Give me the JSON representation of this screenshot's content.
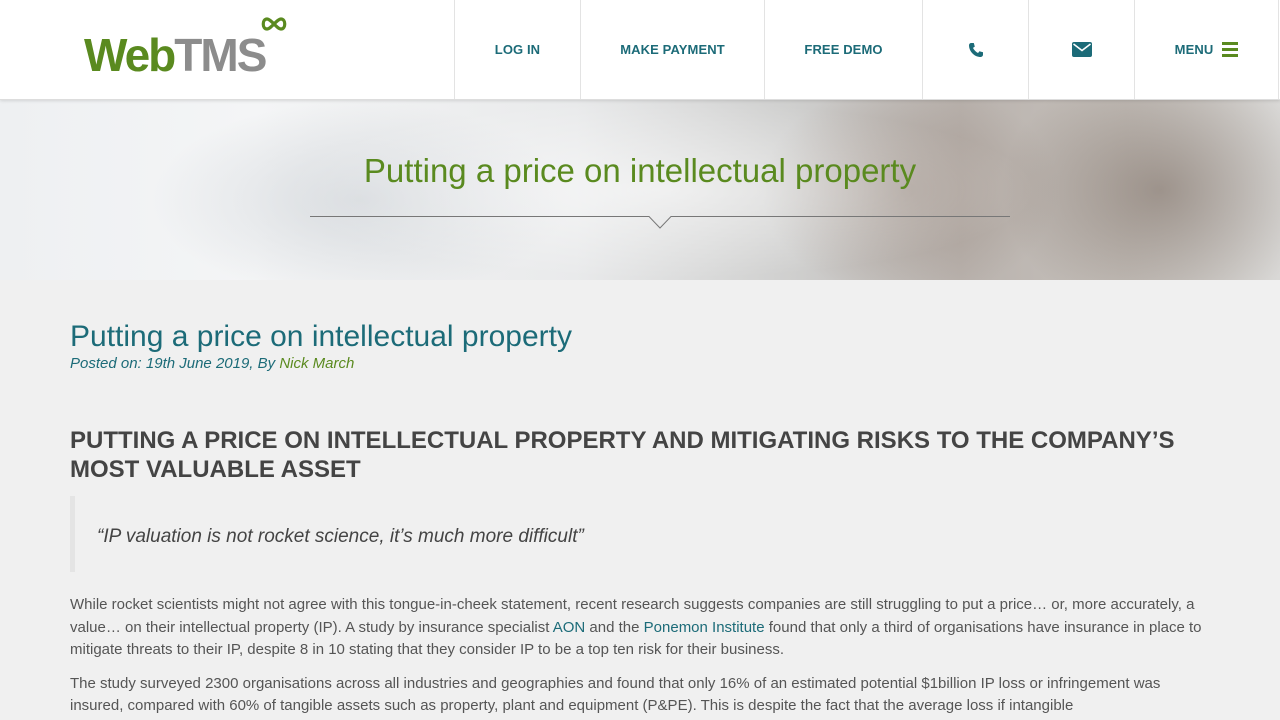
{
  "brand": {
    "logo_text_web": "Web",
    "logo_text_tms": "TMS",
    "logo_icon": "infinity-icon",
    "green": "#5a8a1f",
    "teal": "#1c6b78",
    "grey": "#8c8c8c"
  },
  "nav": {
    "login_label": "LOG IN",
    "payment_label": "MAKE PAYMENT",
    "demo_label": "FREE DEMO",
    "phone_icon": "phone-icon",
    "email_icon": "envelope-icon",
    "menu_label": "MENU",
    "menu_icon": "hamburger-icon"
  },
  "hero": {
    "title": "Putting a price on intellectual property"
  },
  "article": {
    "title": "Putting a price on intellectual property",
    "meta_prefix": "Posted on: 19th June 2019, By ",
    "author": "Nick March",
    "heading": "PUTTING A PRICE ON INTELLECTUAL PROPERTY AND MITIGATING RISKS TO THE COMPANY’S MOST VALUABLE ASSET",
    "quote": "“IP valuation is not rocket science, it’s much more difficult”",
    "p1_a": "While rocket scientists might not agree with this tongue-in-cheek statement, recent research suggests companies are still struggling to put a price… or, more accurately, a value… on their intellectual property (IP). A study by insurance specialist ",
    "p1_link1": "AON",
    "p1_b": " and the ",
    "p1_link2": "Ponemon Institute",
    "p1_c": " found that only a third of organisations have insurance in place to mitigate threats to their IP, despite 8 in 10 stating that they consider IP to be a top ten risk for their business.",
    "p2": "The study surveyed 2300 organisations across all industries and geographies and found that only 16% of an estimated potential $1billion IP loss or infringement was insured, compared with 60% of tangible assets such as property, plant and equipment (P&PE). This is despite the fact that the average loss if intangible"
  }
}
